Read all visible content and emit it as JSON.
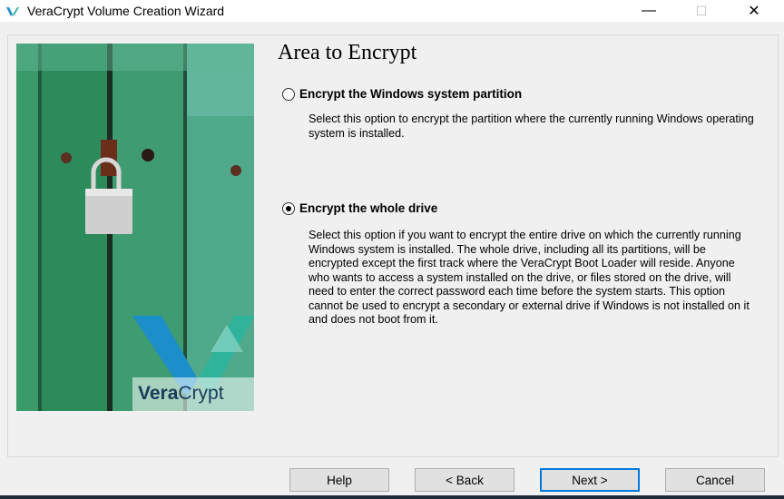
{
  "window": {
    "title": "VeraCrypt Volume Creation Wizard",
    "icon": "veracrypt-logo-icon",
    "controls": {
      "minimize": "—",
      "maximize": "☐",
      "close": "✕"
    }
  },
  "hero": {
    "brand_part1": "Vera",
    "brand_part2": "Crypt",
    "colors": {
      "door": "#2f8a5e",
      "logo_blue": "#1c8ec9",
      "logo_teal": "#2fb39a"
    }
  },
  "page": {
    "heading": "Area to Encrypt"
  },
  "options": [
    {
      "label": "Encrypt the Windows system partition",
      "checked": false,
      "description": "Select this option to encrypt the partition where the currently running Windows operating system is installed."
    },
    {
      "label": "Encrypt the whole drive",
      "checked": true,
      "description": "Select this option if you want to encrypt the entire drive on which the currently running Windows system is installed. The whole drive, including all its partitions, will be encrypted except the first track where the VeraCrypt Boot Loader will reside. Anyone who wants to access a system installed on the drive, or files stored on the drive, will need to enter the correct password each time before the system starts. This option cannot be used to encrypt a secondary or external drive if Windows is not installed on it and does not boot from it."
    }
  ],
  "buttons": {
    "help": "Help",
    "back": "< Back",
    "next": "Next >",
    "cancel": "Cancel"
  }
}
